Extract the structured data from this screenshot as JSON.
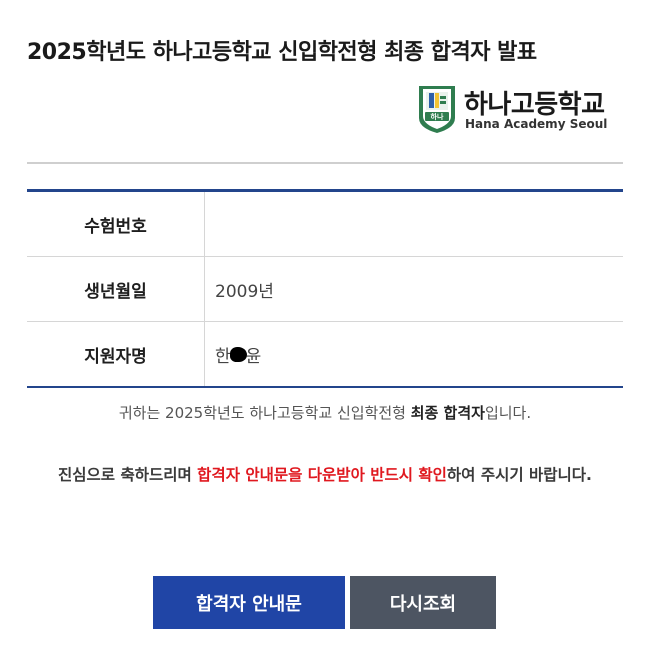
{
  "page": {
    "title": "2025학년도 하나고등학교 신입학전형 최종 합격자 발표"
  },
  "logo": {
    "name_kr": "하나고등학교",
    "name_en": "Hana Academy Seoul",
    "emblem_text": "하나",
    "colors": {
      "green": "#2f7d4f",
      "blue": "#2d5fa8",
      "yellow": "#f1c232"
    }
  },
  "info": {
    "rows": [
      {
        "label": "수험번호",
        "value": ""
      },
      {
        "label": "생년월일",
        "value": "2009년"
      },
      {
        "label": "지원자명",
        "value_prefix": "한",
        "value_suffix": "윤"
      }
    ]
  },
  "message1": {
    "prefix": "귀하는 2025학년도 하나고등학교 신입학전형 ",
    "bold": "최종 합격자",
    "suffix": "입니다."
  },
  "message2": {
    "prefix": "진심으로 축하드리며 ",
    "highlight": "합격자 안내문을 다운받아 반드시 확인",
    "suffix": "하여 주시기 바랍니다."
  },
  "buttons": {
    "notice": "합격자 안내문",
    "recheck": "다시조회"
  },
  "colors": {
    "primary_blue": "#2045a6",
    "table_border": "#23458c",
    "highlight_red": "#e0181f",
    "secondary_gray": "#4d5562"
  }
}
